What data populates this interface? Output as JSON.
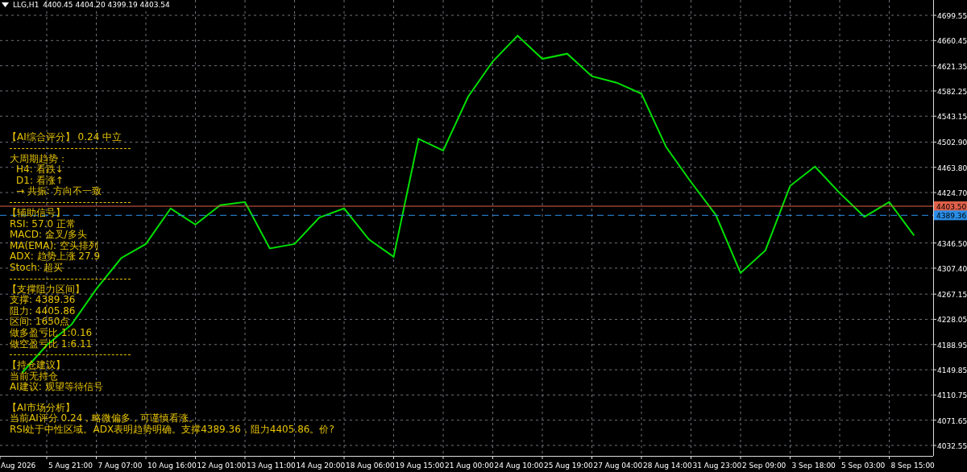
{
  "header": {
    "symbol": "LLG,H1",
    "quote": "4400.45 4404.20 4399.19 4403.54"
  },
  "chart": {
    "chart_data": {
      "type": "line",
      "categories": [
        "Aug 2026",
        null,
        "5 Aug 21:00",
        null,
        "7 Aug 07:00",
        null,
        "10 Aug 16:00",
        null,
        "12 Aug 01:00",
        null,
        "13 Aug 11:00",
        null,
        "14 Aug 20:00",
        null,
        "18 Aug 06:00",
        null,
        "19 Aug 15:00",
        null,
        "21 Aug 00:00",
        null,
        "24 Aug 10:00",
        null,
        "25 Aug 19:00",
        null,
        "27 Aug 04:00",
        null,
        "28 Aug 14:00",
        null,
        "31 Aug 23:00",
        null,
        "2 Sep 09:00",
        null,
        "3 Sep 18:00",
        null,
        "5 Sep 03:00",
        null,
        "8 Sep 15:00",
        null,
        null
      ],
      "series": [
        {
          "color": "#00e000",
          "values": [
            4145,
            4188,
            4220,
            4275,
            4323,
            4345,
            4400,
            4375,
            4405,
            4410,
            4338,
            4345,
            4386,
            4400,
            4352,
            4325,
            4508,
            4490,
            4573,
            4628,
            4668,
            4632,
            4640,
            4605,
            4595,
            4578,
            4495,
            4441,
            4390,
            4300,
            4335,
            4435,
            4465,
            4424,
            4387,
            4410,
            4358,
            null,
            null
          ]
        }
      ],
      "grid": true,
      "ylim": [
        4016.3,
        4723.3
      ],
      "yticks": [
        {
          "value": 4699.55,
          "label": "4699.55"
        },
        {
          "value": 4660.45,
          "label": "4660.45"
        },
        {
          "value": 4621.35,
          "label": "4621.35"
        },
        {
          "value": 4582.25,
          "label": "4582.25"
        },
        {
          "value": 4543.15,
          "label": "4543.15"
        },
        {
          "value": 4502.9,
          "label": "4502.90"
        },
        {
          "value": 4463.8,
          "label": "4463.80"
        },
        {
          "value": 4424.7,
          "label": "4424.70"
        },
        {
          "value": 4346.5,
          "label": "4346.50"
        },
        {
          "value": 4307.4,
          "label": "4307.40"
        },
        {
          "value": 4267.15,
          "label": "4267.15"
        },
        {
          "value": 4228.05,
          "label": "4228.05"
        },
        {
          "value": 4188.95,
          "label": "4188.95"
        },
        {
          "value": 4149.85,
          "label": "4149.85"
        },
        {
          "value": 4110.75,
          "label": "4110.75"
        },
        {
          "value": 4071.65,
          "label": "4071.65"
        },
        {
          "value": 4032.55,
          "label": "4032.55"
        }
      ]
    },
    "price_lines": [
      {
        "label": "4403.50",
        "color": "#e0604a"
      },
      {
        "label": "4389.36",
        "color": "#2a8ee8"
      }
    ]
  },
  "panel": [
    {
      "divider": false,
      "lines": [
        {
          "kind": "title",
          "text": "【AI综合评分】 0.24 中立"
        }
      ]
    },
    {
      "divider": true,
      "lines": [
        {
          "kind": "line",
          "text": "大周期趋势："
        },
        {
          "kind": "sub",
          "text": "H4: 看跌↓"
        },
        {
          "kind": "sub",
          "text": "D1: 看涨↑"
        },
        {
          "kind": "sub",
          "text": "→ 共振: 方向不一致"
        }
      ]
    },
    {
      "divider": true,
      "lines": [
        {
          "kind": "title",
          "text": "【辅助信号】"
        },
        {
          "kind": "line",
          "text": "RSI: 57.0 正常"
        },
        {
          "kind": "line",
          "text": "MACD: 金叉/多头"
        },
        {
          "kind": "line",
          "text": "MA(EMA): 空头排列"
        },
        {
          "kind": "line",
          "text": "ADX: 趋势上涨 27.9"
        },
        {
          "kind": "line",
          "text": "Stoch: 超买"
        }
      ]
    },
    {
      "divider": true,
      "lines": [
        {
          "kind": "title",
          "text": "【支撑阻力区间】"
        },
        {
          "kind": "line",
          "text": "支撑: 4389.36"
        },
        {
          "kind": "line",
          "text": "阻力: 4405.86"
        },
        {
          "kind": "line",
          "text": "区间: 1650点"
        },
        {
          "kind": "line",
          "text": "做多盈亏比 1:0.16"
        },
        {
          "kind": "line",
          "text": "做空盈亏比 1:6.11"
        }
      ]
    },
    {
      "divider": true,
      "lines": [
        {
          "kind": "title",
          "text": "【持仓建议】"
        },
        {
          "kind": "line",
          "text": "当前无持仓"
        },
        {
          "kind": "line",
          "text": "AI建议: 观望等待信号"
        }
      ]
    },
    {
      "divider": false,
      "lines": [
        {
          "kind": "title",
          "text": "【AI市场分析】"
        },
        {
          "kind": "line",
          "text": "当前AI评分 0.24，略微偏多，可谨慎看涨。"
        },
        {
          "kind": "line",
          "text": "RSI处于中性区域。ADX表明趋势明确。支撑4389.36，阻力4405.86。价?"
        }
      ]
    }
  ]
}
